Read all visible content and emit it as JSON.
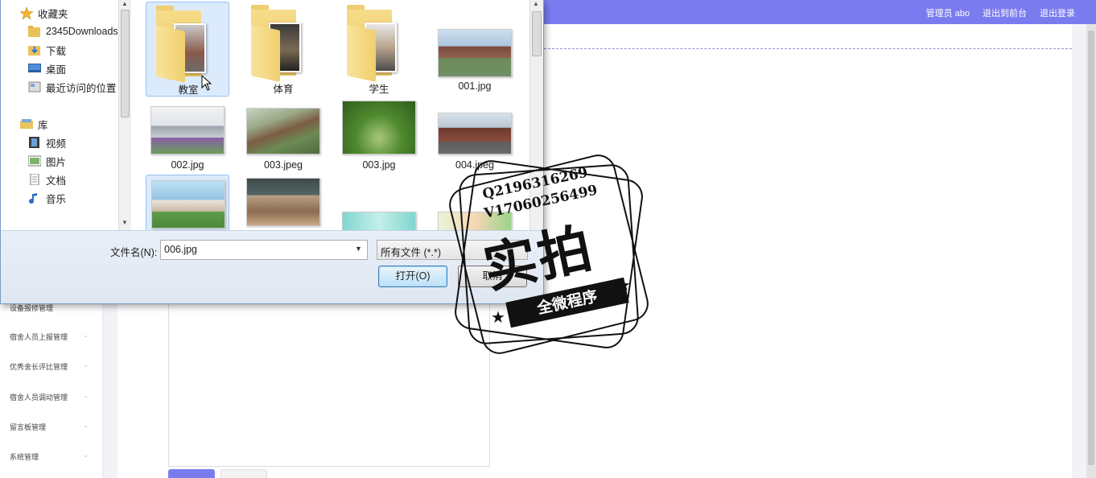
{
  "topbar": {
    "admin_label": "管理员 abo",
    "front_link": "退出到前台",
    "logout_link": "退出登录"
  },
  "left_nav": {
    "items": [
      {
        "label": "设备报修管理"
      },
      {
        "label": "宿舍人员上报管理"
      },
      {
        "label": "优秀舍长评比管理"
      },
      {
        "label": "宿舍人员调动管理"
      },
      {
        "label": "留言板管理"
      },
      {
        "label": "系统管理"
      }
    ]
  },
  "form": {
    "save_label": "",
    "reset_label": ""
  },
  "dialog": {
    "nav": {
      "favorites": "收藏夹",
      "favorites_items": [
        "2345Downloads",
        "下载",
        "桌面",
        "最近访问的位置"
      ],
      "library": "库",
      "library_items": [
        "视频",
        "图片",
        "文档",
        "音乐"
      ]
    },
    "files": [
      {
        "name": "教室",
        "kind": "folder",
        "selected": true
      },
      {
        "name": "体育",
        "kind": "folder"
      },
      {
        "name": "学生",
        "kind": "folder"
      },
      {
        "name": "001.jpg",
        "kind": "image"
      },
      {
        "name": "002.jpg",
        "kind": "image"
      },
      {
        "name": "003.jpeg",
        "kind": "image"
      },
      {
        "name": "003.jpg",
        "kind": "image"
      },
      {
        "name": "004.jpeg",
        "kind": "image"
      },
      {
        "name": "",
        "kind": "image",
        "selected": true
      },
      {
        "name": "",
        "kind": "image"
      },
      {
        "name": "",
        "kind": "image"
      },
      {
        "name": "",
        "kind": "image"
      }
    ],
    "filename_label": "文件名(N):",
    "filename_value": "006.jpg",
    "filetype_value": "所有文件 (*.*)",
    "open_button": "打开(O)",
    "cancel_button": "取消"
  },
  "watermark": {
    "line1": "Q2196316269",
    "line2": "V17060256499",
    "big_text": "实拍",
    "ribbon_text": "全微程序"
  },
  "colors": {
    "topbar": "#7b7bf0",
    "selection": "#dcebfc",
    "accent_button": "#7b7bf0"
  }
}
